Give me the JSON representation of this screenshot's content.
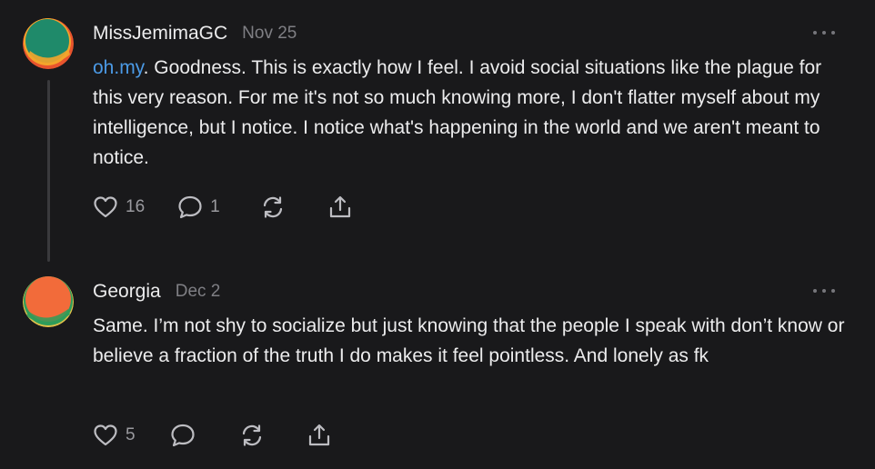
{
  "comments": [
    {
      "author": "MissJemimaGC",
      "date": "Nov 25",
      "mention": "oh.my",
      "text": ". Goodness. This is exactly how I feel. I avoid social situations like the plague for this very reason. For me it's not so much knowing more, I don't flatter myself about my intelligence, but I notice. I notice what's happening in the world and we aren't meant to notice.",
      "likes": "16",
      "replies": "1",
      "avatar_colors": [
        "#1f8a6a",
        "#f4a52b",
        "#e8542d"
      ]
    },
    {
      "author": "Georgia",
      "date": "Dec 2",
      "text": "Same. I’m not shy to socialize but just knowing that the people I speak with don’t know or believe a fraction of the truth I do makes it feel pointless. And lonely as fk",
      "likes": "5",
      "replies": "",
      "avatar_colors": [
        "#f26b3a",
        "#2e9c5a",
        "#e0c04a"
      ]
    }
  ],
  "icons": {
    "like": "heart-icon",
    "reply": "comment-bubble-icon",
    "restack": "restack-icon",
    "share": "share-icon",
    "more": "more-options-icon"
  },
  "colors": {
    "background": "#19191b",
    "text": "#ececed",
    "muted": "#7f7f84",
    "mention": "#4b9ae6"
  }
}
